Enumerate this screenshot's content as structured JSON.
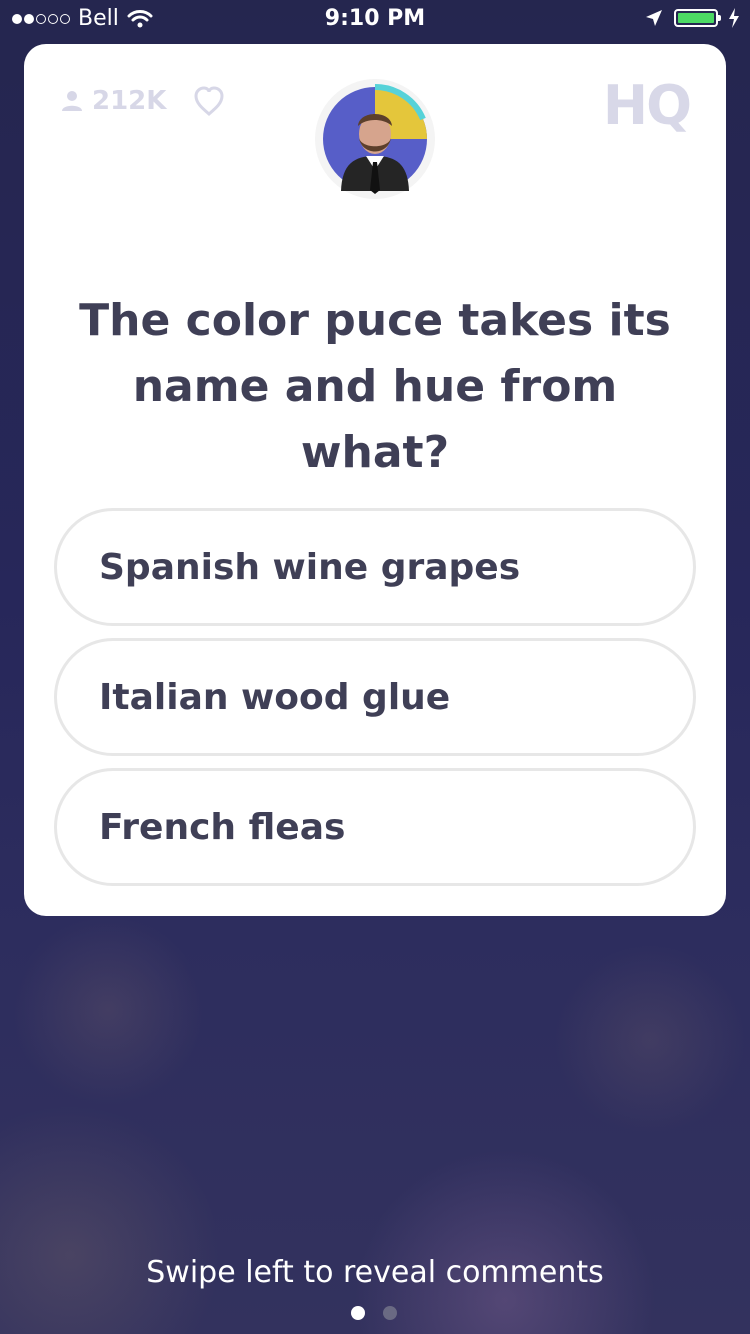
{
  "status_bar": {
    "carrier": "Bell",
    "time": "9:10 PM"
  },
  "game": {
    "viewer_count": "212K",
    "logo": "HQ",
    "question": "The color puce takes its name and hue from what?",
    "answers": [
      "Spanish wine grapes",
      "Italian wood glue",
      "French fleas"
    ]
  },
  "footer": {
    "swipe_hint": "Swipe left to reveal comments"
  },
  "colors": {
    "background": "#27275a",
    "card": "#ffffff",
    "text": "#3f3f56",
    "muted": "#d7d7e7",
    "answer_border": "#e7e7e7",
    "timer_accent": "#56d2d8",
    "battery": "#4cd964"
  },
  "icons": [
    "signal-dots-icon",
    "wifi-icon",
    "location-arrow-icon",
    "battery-icon",
    "charging-bolt-icon",
    "viewer-icon",
    "heart-icon"
  ]
}
